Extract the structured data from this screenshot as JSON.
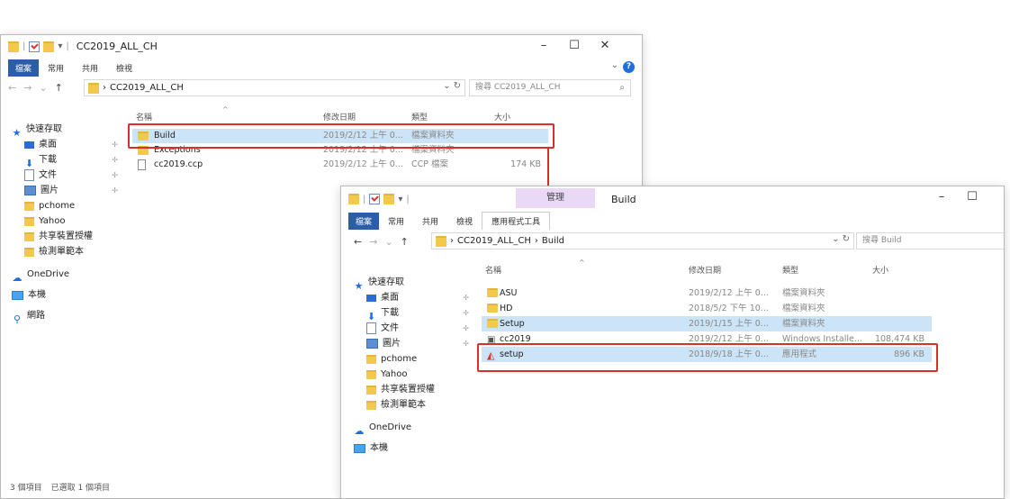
{
  "window1": {
    "title": "CC2019_ALL_CH",
    "ribbon_tabs": [
      "檔案",
      "常用",
      "共用",
      "檢視"
    ],
    "breadcrumb": [
      "CC2019_ALL_CH"
    ],
    "search_placeholder": "搜尋 CC2019_ALL_CH",
    "columns": [
      "名稱",
      "修改日期",
      "類型",
      "大小"
    ],
    "files": [
      {
        "name": "Build",
        "date": "2019/2/12 上午 0...",
        "type": "檔案資料夾",
        "size": "",
        "icon": "folder-icon",
        "selected": true
      },
      {
        "name": "Exceptions",
        "date": "2019/2/12 上午 0...",
        "type": "檔案資料夾",
        "size": "",
        "icon": "folder-icon",
        "selected": false
      },
      {
        "name": "cc2019.ccp",
        "date": "2019/2/12 上午 0...",
        "type": "CCP 檔案",
        "size": "174 KB",
        "icon": "document-icon",
        "selected": false
      }
    ],
    "nav_items": [
      {
        "label": "快速存取",
        "icon": "star-icon",
        "pinned": false
      },
      {
        "label": "桌面",
        "icon": "desktop-icon",
        "pinned": true
      },
      {
        "label": "下載",
        "icon": "download-icon",
        "pinned": true
      },
      {
        "label": "文件",
        "icon": "document-icon",
        "pinned": true
      },
      {
        "label": "圖片",
        "icon": "picture-icon",
        "pinned": true
      },
      {
        "label": "pchome",
        "icon": "folder-icon",
        "pinned": false
      },
      {
        "label": "Yahoo",
        "icon": "folder-icon",
        "pinned": false
      },
      {
        "label": "共享裝置授權",
        "icon": "folder-icon",
        "pinned": false
      },
      {
        "label": "檢測單範本",
        "icon": "folder-icon",
        "pinned": false
      }
    ],
    "nav_extra": [
      {
        "label": "OneDrive",
        "icon": "onedrive-icon"
      },
      {
        "label": "本機",
        "icon": "pc-icon"
      },
      {
        "label": "網路",
        "icon": "network-icon"
      }
    ],
    "status": {
      "count": "3 個項目",
      "selected": "已選取 1 個項目"
    }
  },
  "window2": {
    "title": "Build",
    "context_header": "管理",
    "ribbon_tabs": [
      "檔案",
      "常用",
      "共用",
      "檢視",
      "應用程式工具"
    ],
    "breadcrumb": [
      "CC2019_ALL_CH",
      "Build"
    ],
    "search_placeholder": "搜尋 Build",
    "columns": [
      "名稱",
      "修改日期",
      "類型",
      "大小"
    ],
    "files": [
      {
        "name": "ASU",
        "date": "2019/2/12 上午 0...",
        "type": "檔案資料夾",
        "size": "",
        "icon": "folder-icon",
        "selected": false
      },
      {
        "name": "HD",
        "date": "2018/5/2 下午 10...",
        "type": "檔案資料夾",
        "size": "",
        "icon": "folder-icon",
        "selected": false
      },
      {
        "name": "Setup",
        "date": "2019/1/15 上午 0...",
        "type": "檔案資料夾",
        "size": "",
        "icon": "folder-icon",
        "selected": true
      },
      {
        "name": "cc2019",
        "date": "2019/2/12 上午 0...",
        "type": "Windows Installe...",
        "size": "108,474 KB",
        "icon": "msi-icon",
        "selected": false
      },
      {
        "name": "setup",
        "date": "2018/9/18 上午 0...",
        "type": "應用程式",
        "size": "896 KB",
        "icon": "app-icon",
        "selected": true
      }
    ],
    "nav_items": [
      {
        "label": "快速存取",
        "icon": "star-icon",
        "pinned": false
      },
      {
        "label": "桌面",
        "icon": "desktop-icon",
        "pinned": true
      },
      {
        "label": "下載",
        "icon": "download-icon",
        "pinned": true
      },
      {
        "label": "文件",
        "icon": "document-icon",
        "pinned": true
      },
      {
        "label": "圖片",
        "icon": "picture-icon",
        "pinned": true
      },
      {
        "label": "pchome",
        "icon": "folder-icon",
        "pinned": false
      },
      {
        "label": "Yahoo",
        "icon": "folder-icon",
        "pinned": false
      },
      {
        "label": "共享裝置授權",
        "icon": "folder-icon",
        "pinned": false
      },
      {
        "label": "檢測單範本",
        "icon": "folder-icon",
        "pinned": false
      }
    ],
    "nav_extra": [
      {
        "label": "OneDrive",
        "icon": "onedrive-icon"
      },
      {
        "label": "本機",
        "icon": "pc-icon"
      }
    ]
  },
  "colors": {
    "highlight": "#d9302a",
    "selection": "#cce4f7",
    "accent": "#2b5ea7"
  }
}
